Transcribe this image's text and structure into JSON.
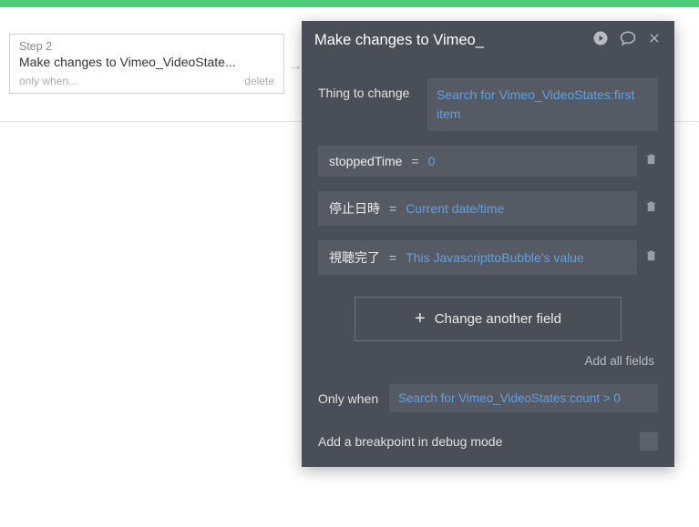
{
  "step_card": {
    "step_label": "Step 2",
    "title": "Make changes to Vimeo_VideoState...",
    "only_when_label": "only when...",
    "delete_label": "delete"
  },
  "panel": {
    "title": "Make changes to Vimeo_",
    "thing_label": "Thing to change",
    "thing_value": "Search for Vimeo_VideoStates:first item",
    "fields": [
      {
        "name": "stoppedTime",
        "value": "0"
      },
      {
        "name": "停止日時",
        "value": "Current date/time"
      },
      {
        "name": "視聴完了",
        "value": "This JavascripttoBubble's value"
      }
    ],
    "change_another_label": "Change another field",
    "add_all_label": "Add all fields",
    "only_when_label": "Only when",
    "only_when_value": "Search for Vimeo_VideoStates:count > 0",
    "breakpoint_label": "Add a breakpoint in debug mode"
  }
}
